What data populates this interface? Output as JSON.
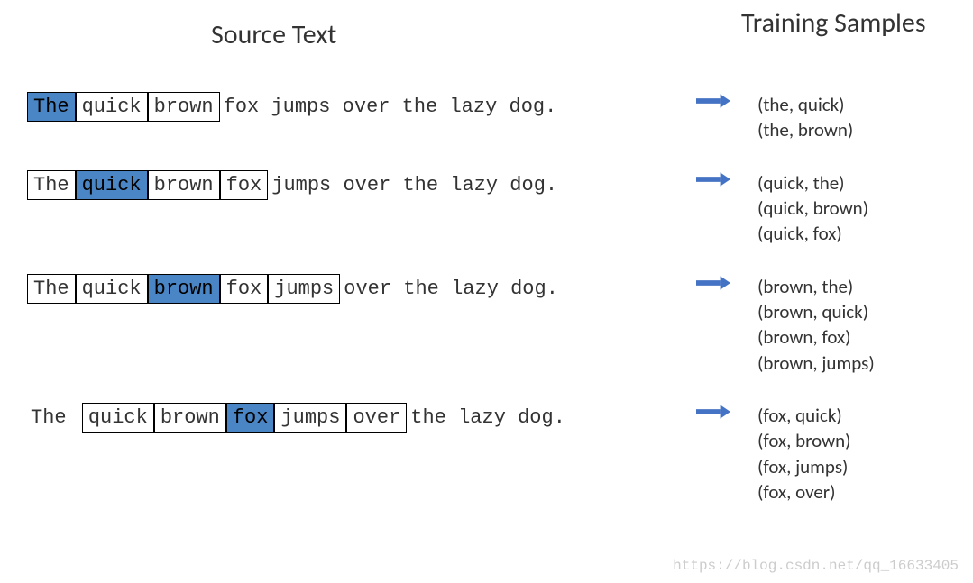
{
  "headers": {
    "source": "Source Text",
    "samples": "Training Samples"
  },
  "rows": [
    {
      "words": [
        {
          "text": "The",
          "boxed": true,
          "highlighted": true
        },
        {
          "text": "quick",
          "boxed": true,
          "highlighted": false
        },
        {
          "text": "brown",
          "boxed": true,
          "highlighted": false
        },
        {
          "text": "fox jumps over the lazy dog.",
          "boxed": false,
          "highlighted": false
        }
      ],
      "samples": [
        "(the, quick)",
        "(the, brown)"
      ]
    },
    {
      "words": [
        {
          "text": "The",
          "boxed": true,
          "highlighted": false
        },
        {
          "text": "quick",
          "boxed": true,
          "highlighted": true
        },
        {
          "text": "brown",
          "boxed": true,
          "highlighted": false
        },
        {
          "text": "fox",
          "boxed": true,
          "highlighted": false
        },
        {
          "text": "jumps over the lazy dog.",
          "boxed": false,
          "highlighted": false
        }
      ],
      "samples": [
        "(quick, the)",
        "(quick, brown)",
        "(quick, fox)"
      ]
    },
    {
      "words": [
        {
          "text": "The",
          "boxed": true,
          "highlighted": false
        },
        {
          "text": "quick",
          "boxed": true,
          "highlighted": false
        },
        {
          "text": "brown",
          "boxed": true,
          "highlighted": true
        },
        {
          "text": "fox",
          "boxed": true,
          "highlighted": false
        },
        {
          "text": "jumps",
          "boxed": true,
          "highlighted": false
        },
        {
          "text": "over the lazy dog.",
          "boxed": false,
          "highlighted": false
        }
      ],
      "samples": [
        "(brown, the)",
        "(brown, quick)",
        "(brown, fox)",
        "(brown, jumps)"
      ]
    },
    {
      "words": [
        {
          "text": "The ",
          "boxed": false,
          "highlighted": false
        },
        {
          "text": "quick",
          "boxed": true,
          "highlighted": false
        },
        {
          "text": "brown",
          "boxed": true,
          "highlighted": false
        },
        {
          "text": "fox",
          "boxed": true,
          "highlighted": true
        },
        {
          "text": "jumps",
          "boxed": true,
          "highlighted": false
        },
        {
          "text": "over",
          "boxed": true,
          "highlighted": false
        },
        {
          "text": "the lazy dog.",
          "boxed": false,
          "highlighted": false
        }
      ],
      "samples": [
        "(fox, quick)",
        "(fox, brown)",
        "(fox, jumps)",
        "(fox, over)"
      ]
    }
  ],
  "watermark": "https://blog.csdn.net/qq_16633405"
}
